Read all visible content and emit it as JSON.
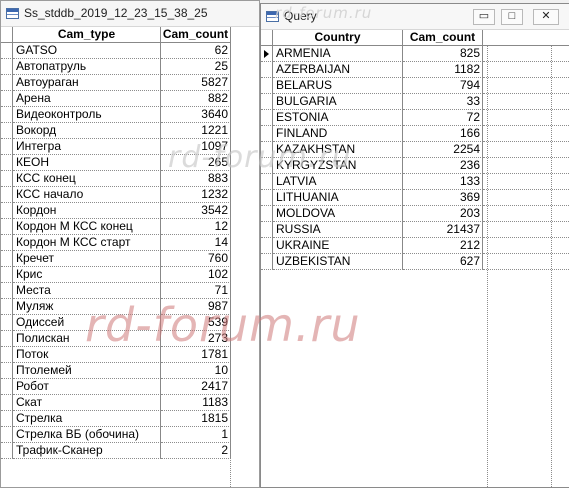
{
  "window1": {
    "title": "Ss_stddb_2019_12_23_15_38_25",
    "columns": [
      "Cam_type",
      "Cam_count"
    ],
    "rows": [
      [
        "GATSO",
        "62"
      ],
      [
        "Автопатруль",
        "25"
      ],
      [
        "Автоураган",
        "5827"
      ],
      [
        "Арена",
        "882"
      ],
      [
        "Видеоконтроль",
        "3640"
      ],
      [
        "Вокорд",
        "1221"
      ],
      [
        "Интегра",
        "1097"
      ],
      [
        "КЕОН",
        "265"
      ],
      [
        "КСС конец",
        "883"
      ],
      [
        "КСС начало",
        "1232"
      ],
      [
        "Кордон",
        "3542"
      ],
      [
        "Кордон М КСС конец",
        "12"
      ],
      [
        "Кордон М КСС старт",
        "14"
      ],
      [
        "Кречет",
        "760"
      ],
      [
        "Крис",
        "102"
      ],
      [
        "Места",
        "71"
      ],
      [
        "Муляж",
        "987"
      ],
      [
        "Одиссей",
        "539"
      ],
      [
        "Полискан",
        "273"
      ],
      [
        "Поток",
        "1781"
      ],
      [
        "Птолемей",
        "10"
      ],
      [
        "Робот",
        "2417"
      ],
      [
        "Скат",
        "1183"
      ],
      [
        "Стрелка",
        "1815"
      ],
      [
        "Стрелка ВБ (обочина)",
        "1"
      ],
      [
        "Трафик-Сканер",
        "2"
      ]
    ]
  },
  "window2": {
    "title": "Query",
    "columns": [
      "Country",
      "Cam_count"
    ],
    "rows": [
      [
        "ARMENIA",
        "825"
      ],
      [
        "AZERBAIJAN",
        "1182"
      ],
      [
        "BELARUS",
        "794"
      ],
      [
        "BULGARIA",
        "33"
      ],
      [
        "ESTONIA",
        "72"
      ],
      [
        "FINLAND",
        "166"
      ],
      [
        "KAZAKHSTAN",
        "2254"
      ],
      [
        "KYRGYZSTAN",
        "236"
      ],
      [
        "LATVIA",
        "133"
      ],
      [
        "LITHUANIA",
        "369"
      ],
      [
        "MOLDOVA",
        "203"
      ],
      [
        "RUSSIA",
        "21437"
      ],
      [
        "UKRAINE",
        "212"
      ],
      [
        "UZBEKISTAN",
        "627"
      ]
    ],
    "buttons": {
      "minimize": "▭",
      "maximize": "□",
      "close": "✕"
    }
  },
  "watermarks": {
    "big": "rd-forum.ru",
    "mid": "rd-forum.ru",
    "top": "rd-forum.ru"
  }
}
